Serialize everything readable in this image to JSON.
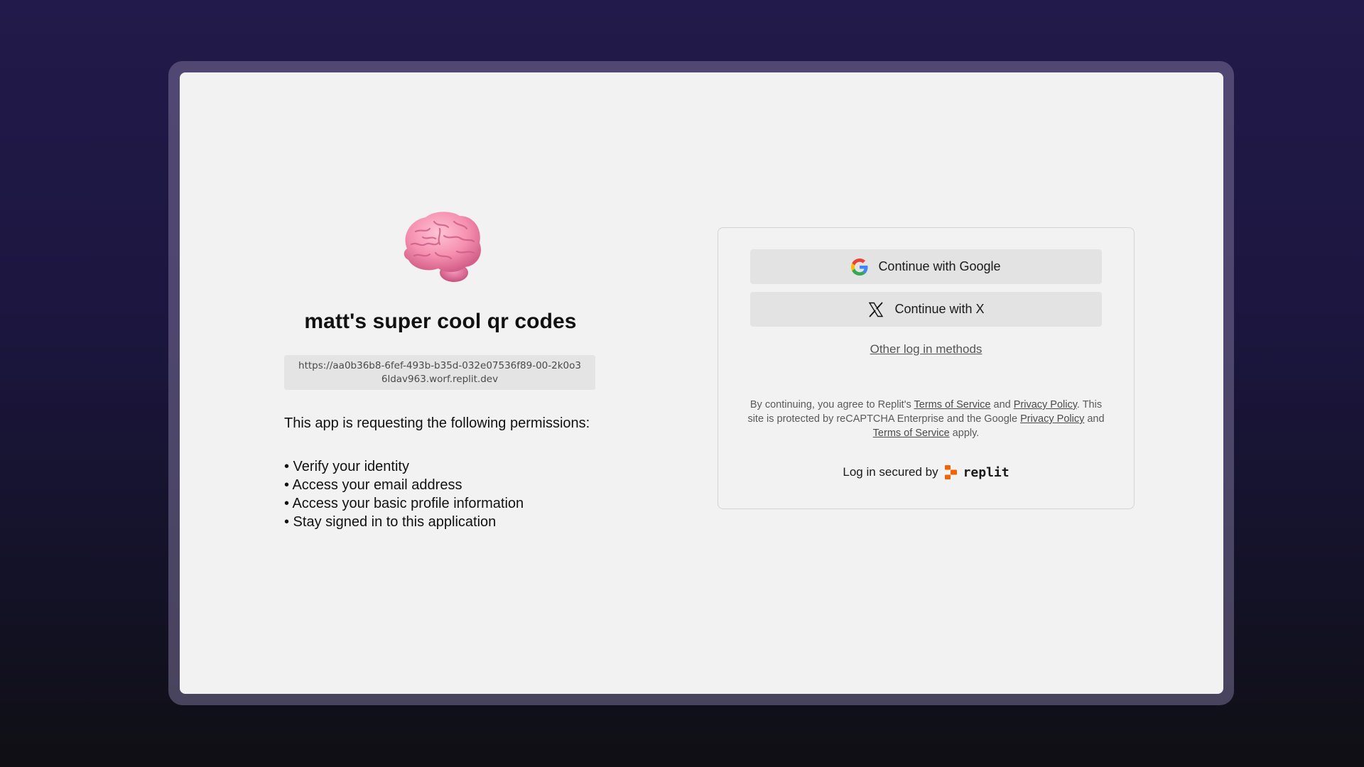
{
  "app": {
    "logo_icon": "brain-emoji-icon",
    "title": "matt's super cool qr codes",
    "url": "https://aa0b36b8-6fef-493b-b35d-032e07536f89-00-2k0o36ldav963.worf.replit.dev"
  },
  "permissions": {
    "intro": "This app is requesting the following permissions:",
    "items": [
      "• Verify your identity",
      "• Access your email address",
      "• Access your basic profile information",
      "• Stay signed in to this application"
    ]
  },
  "login": {
    "google_label": "Continue with Google",
    "google_icon": "google-icon",
    "x_label": "Continue with X",
    "x_icon": "x-logo-icon",
    "other_methods": "Other log in methods"
  },
  "legal": {
    "part1": "By continuing, you agree to Replit's ",
    "terms": "Terms of Service",
    "and1": " and ",
    "privacy": "Privacy Policy",
    "part2": ". This site is protected by reCAPTCHA Enterprise and the Google ",
    "google_privacy": "Privacy Policy",
    "and2": " and ",
    "google_terms": "Terms of Service",
    "part3": " apply."
  },
  "footer": {
    "secured_by": "Log in secured by",
    "brand": "replit",
    "brand_color": "#f26207"
  },
  "colors": {
    "window_bg": "#f2f2f2",
    "button_bg": "#e3e3e3",
    "background_top": "#221a4a",
    "background_bottom": "#0f0f14"
  }
}
